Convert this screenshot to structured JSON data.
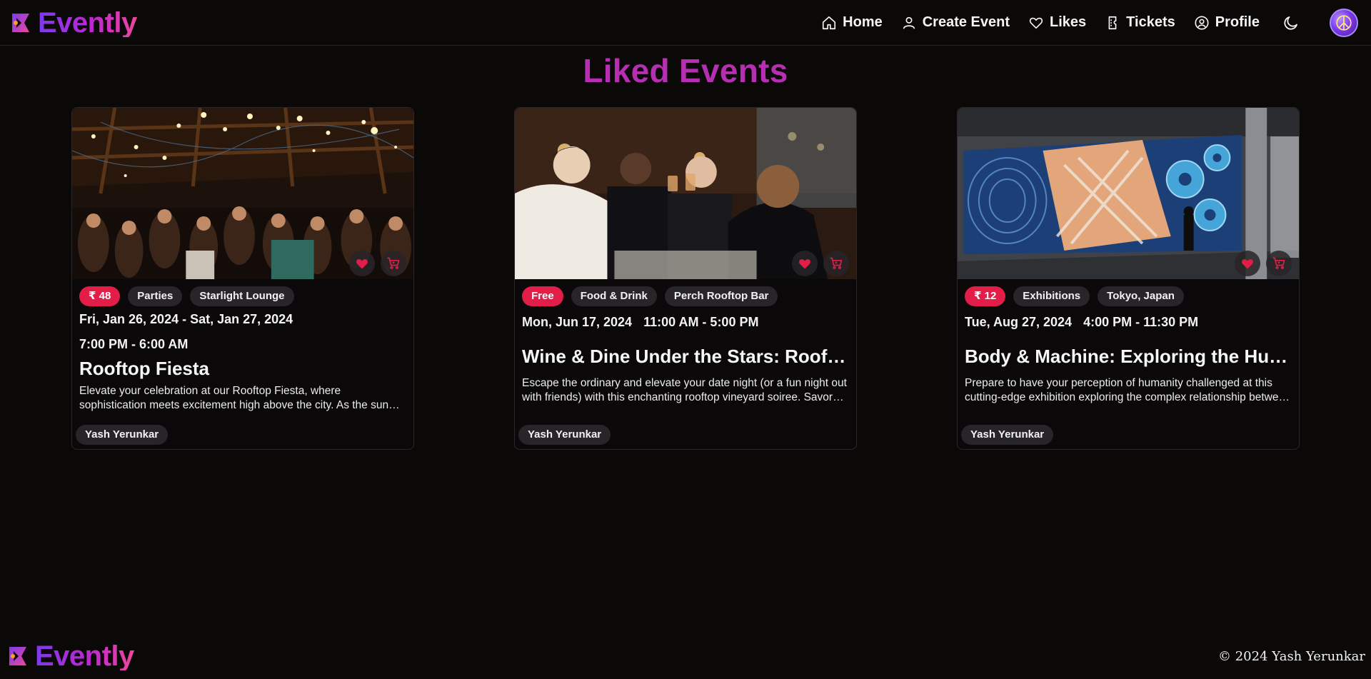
{
  "header": {
    "brand": "Evently",
    "nav": [
      {
        "label": "Home",
        "icon": "home-icon"
      },
      {
        "label": "Create Event",
        "icon": "user-icon"
      },
      {
        "label": "Likes",
        "icon": "heart-outline-icon"
      },
      {
        "label": "Tickets",
        "icon": "ticket-icon"
      },
      {
        "label": "Profile",
        "icon": "profile-circle-icon"
      }
    ],
    "theme_icon": "moon-icon",
    "avatar_icon": "peace-sign-icon"
  },
  "page": {
    "title": "Liked Events"
  },
  "events": [
    {
      "price": "₹ 48",
      "category": "Parties",
      "location": "Starlight Lounge",
      "date": "Fri, Jan 26, 2024 - Sat, Jan 27, 2024",
      "time": "7:00 PM - 6:00 AM",
      "title": "Rooftop Fiesta",
      "description": "Elevate your celebration at our Rooftop Fiesta, where sophistication meets excitement high above the city. As the sun sets over the skyline, join us for an unforgettable night.",
      "organizer": "Yash Yerunkar",
      "liked": true
    },
    {
      "price": "Free",
      "category": "Food & Drink",
      "location": "Perch Rooftop Bar",
      "date": "Mon, Jun 17, 2024",
      "time": "11:00 AM - 5:00 PM",
      "title": "Wine & Dine Under the Stars: Rooftop Vineyard Soiree",
      "description": "Escape the ordinary and elevate your date night (or a fun night out with friends) with this enchanting rooftop vineyard soiree. Savor fine wines under the stars.",
      "organizer": "Yash Yerunkar",
      "liked": true
    },
    {
      "price": "₹ 12",
      "category": "Exhibitions",
      "location": "Tokyo, Japan",
      "date": "Tue, Aug 27, 2024",
      "time": "4:00 PM - 11:30 PM",
      "title": "Body & Machine: Exploring the Human-Technology Connection",
      "description": "Prepare to have your perception of humanity challenged at this cutting-edge exhibition exploring the complex relationship between our bodies and machines.",
      "organizer": "Yash Yerunkar",
      "liked": true
    }
  ],
  "footer": {
    "brand": "Evently",
    "copyright": "© 2024 Yash Yerunkar"
  },
  "colors": {
    "background": "#0b0908",
    "accent_title": "#b62fb2",
    "price_badge": "#e21d48",
    "chip_bg": "#27252a",
    "like_heart": "#e21d48"
  }
}
